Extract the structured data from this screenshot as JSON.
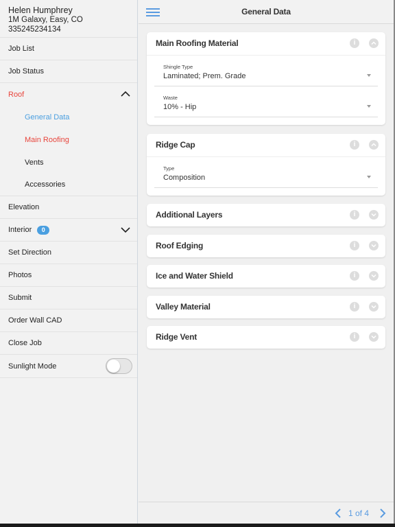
{
  "user": {
    "name": "Helen Humphrey",
    "address": "1M Galaxy, Easy, CO",
    "phone": "335245234134"
  },
  "sidebar": {
    "items": [
      {
        "label": "Job List"
      },
      {
        "label": "Job Status"
      },
      {
        "label": "Roof"
      },
      {
        "label": "General Data"
      },
      {
        "label": "Main Roofing"
      },
      {
        "label": "Vents"
      },
      {
        "label": "Accessories"
      },
      {
        "label": "Elevation"
      },
      {
        "label": "Interior",
        "badge": "0"
      },
      {
        "label": "Set Direction"
      },
      {
        "label": "Photos"
      },
      {
        "label": "Submit"
      },
      {
        "label": "Order Wall CAD"
      },
      {
        "label": "Close Job"
      },
      {
        "label": "Sunlight Mode",
        "toggle": false
      }
    ]
  },
  "header": {
    "title": "General Data"
  },
  "sections": [
    {
      "title": "Main Roofing Material",
      "expanded": true,
      "fields": [
        {
          "label": "Shingle Type",
          "value": "Laminated; Prem. Grade"
        },
        {
          "label": "Waste",
          "value": "10% - Hip"
        }
      ]
    },
    {
      "title": "Ridge Cap",
      "expanded": true,
      "fields": [
        {
          "label": "Type",
          "value": "Composition"
        }
      ]
    },
    {
      "title": "Additional Layers",
      "expanded": false
    },
    {
      "title": "Roof Edging",
      "expanded": false
    },
    {
      "title": "Ice and Water Shield",
      "expanded": false
    },
    {
      "title": "Valley Material",
      "expanded": false
    },
    {
      "title": "Ridge Vent",
      "expanded": false
    }
  ],
  "pager": {
    "text": "1 of 4"
  },
  "icons": {
    "info": "info-icon",
    "chevron": "chevron-icon",
    "menu": "hamburger-icon"
  },
  "colors": {
    "accent_blue": "#4a9fe0",
    "accent_red": "#e8453c",
    "text": "#222222"
  }
}
